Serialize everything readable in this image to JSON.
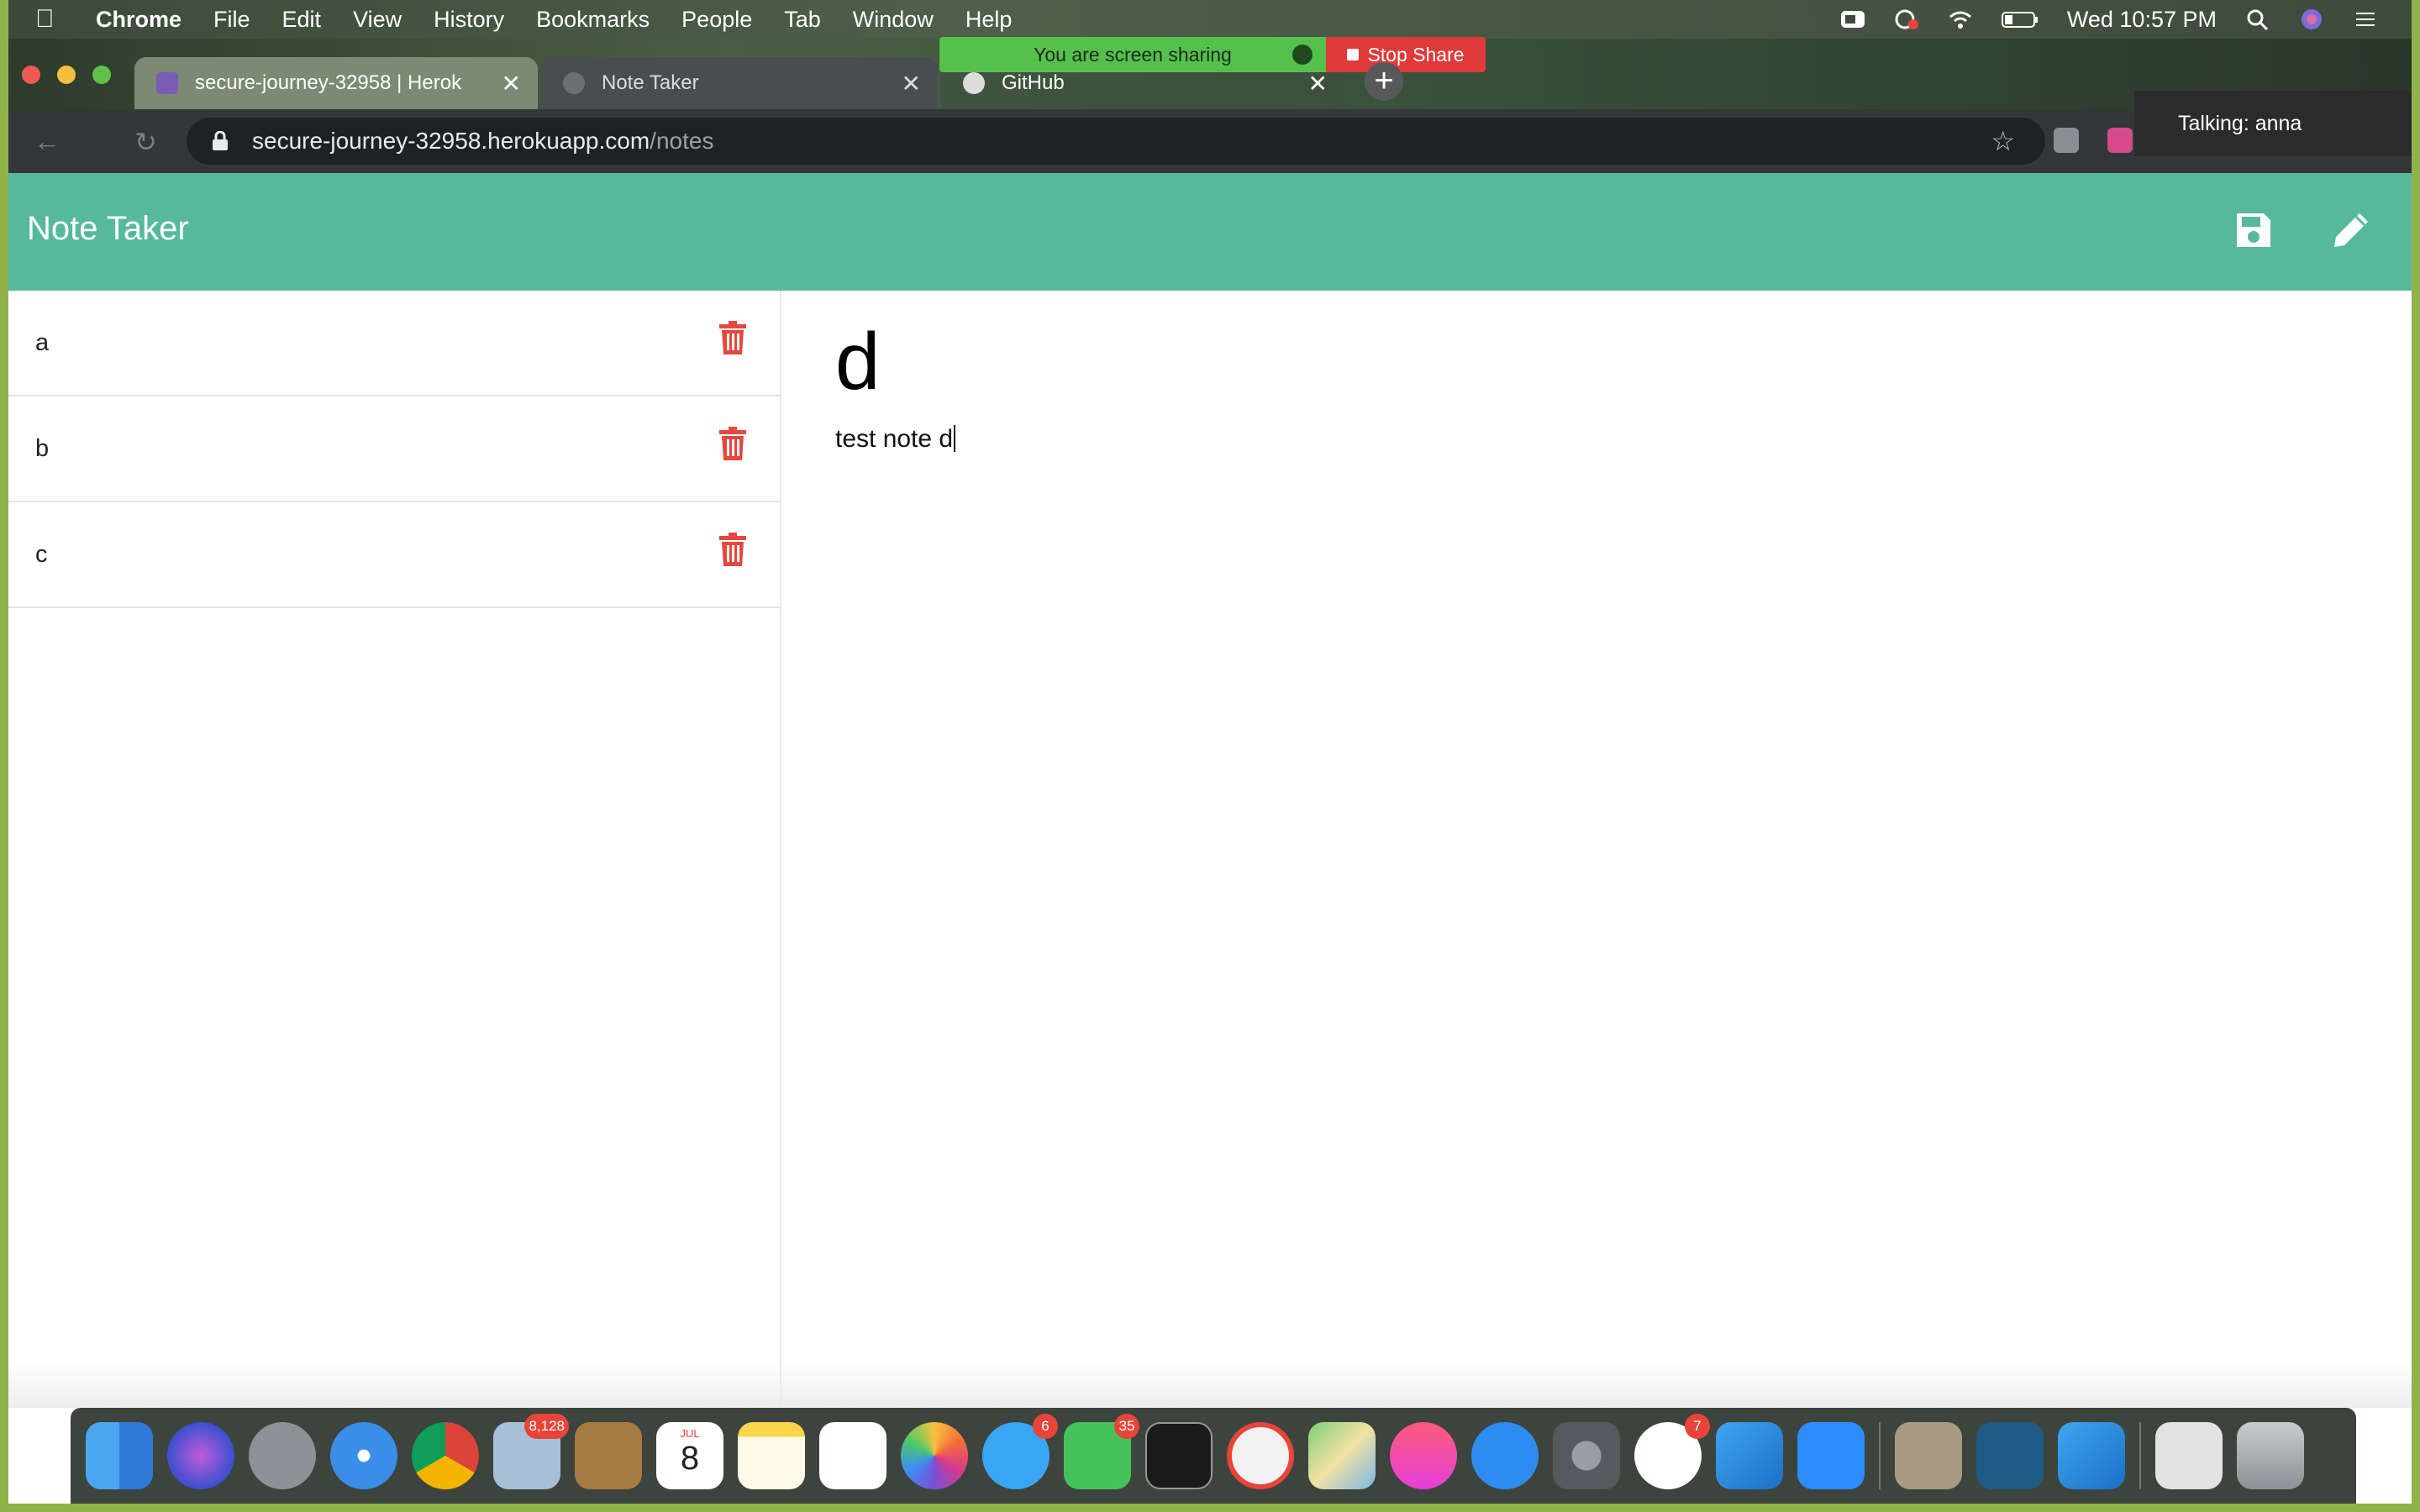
{
  "menubar": {
    "app_name": "Chrome",
    "items": [
      "File",
      "Edit",
      "View",
      "History",
      "Bookmarks",
      "People",
      "Tab",
      "Window",
      "Help"
    ],
    "clock": "Wed 10:57 PM"
  },
  "tabs": [
    {
      "title": "secure-journey-32958 | Herok",
      "active": false
    },
    {
      "title": "Note Taker",
      "active": true
    },
    {
      "title": "GitHub",
      "active": false
    }
  ],
  "screen_share": {
    "status": "You are screen sharing",
    "stop_label": "Stop Share",
    "talking": "Talking: anna"
  },
  "address_bar": {
    "host": "secure-journey-32958.herokuapp.com",
    "path": "/notes"
  },
  "app": {
    "title": "Note Taker",
    "accent_color": "#56b99c",
    "delete_color": "#e5473f",
    "notes": [
      {
        "title": "a"
      },
      {
        "title": "b"
      },
      {
        "title": "c"
      }
    ],
    "active_note": {
      "title": "d",
      "text": "test note d"
    }
  },
  "dock": {
    "badges": {
      "mail": "8,128",
      "messages": "6",
      "facetime": "35",
      "slack": "7"
    },
    "calendar": {
      "month": "JUL",
      "day": "8"
    }
  }
}
